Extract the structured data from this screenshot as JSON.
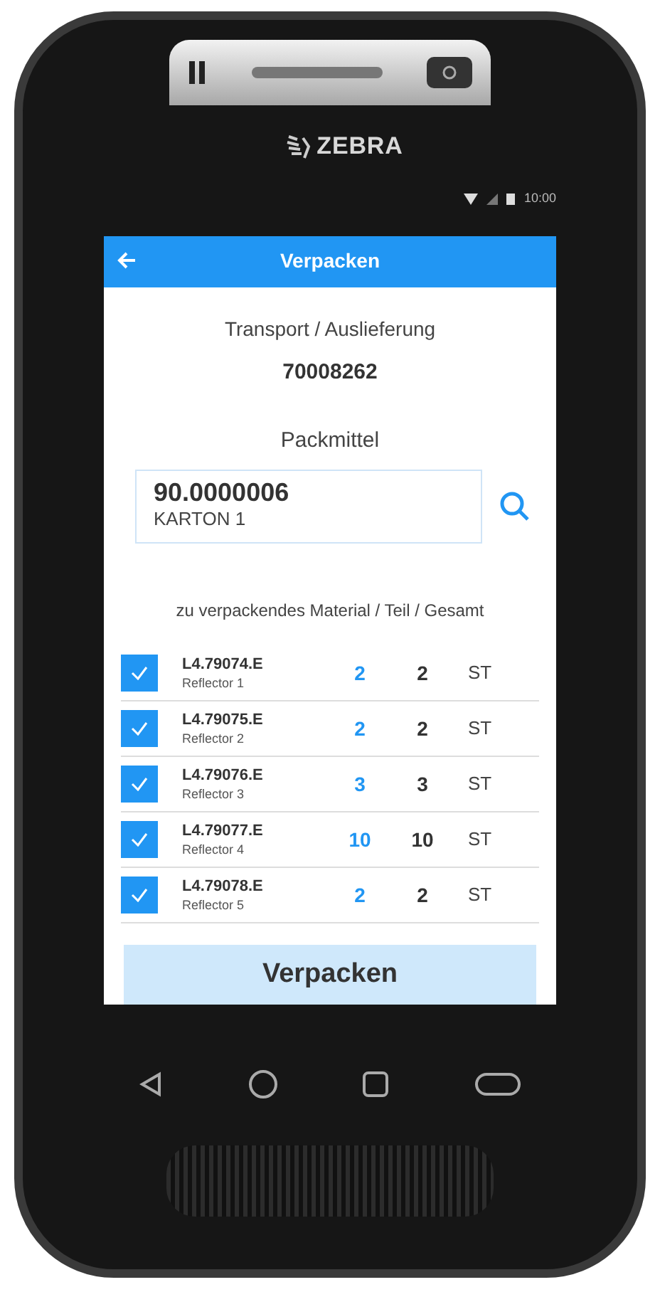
{
  "device": {
    "brand": "ZEBRA"
  },
  "status_bar": {
    "time": "10:00"
  },
  "app_bar": {
    "title": "Verpacken"
  },
  "delivery": {
    "label": "Transport / Auslieferung",
    "number": "70008262"
  },
  "packmittel": {
    "label": "Packmittel",
    "code": "90.0000006",
    "name": "KARTON 1"
  },
  "materials": {
    "heading": "zu verpackendes Material / Teil / Gesamt",
    "rows": [
      {
        "material": "L4.79074.E",
        "description": "Reflector 1",
        "part": "2",
        "total": "2",
        "unit": "ST",
        "checked": true
      },
      {
        "material": "L4.79075.E",
        "description": "Reflector 2",
        "part": "2",
        "total": "2",
        "unit": "ST",
        "checked": true
      },
      {
        "material": "L4.79076.E",
        "description": "Reflector 3",
        "part": "3",
        "total": "3",
        "unit": "ST",
        "checked": true
      },
      {
        "material": "L4.79077.E",
        "description": "Reflector 4",
        "part": "10",
        "total": "10",
        "unit": "ST",
        "checked": true
      },
      {
        "material": "L4.79078.E",
        "description": "Reflector 5",
        "part": "2",
        "total": "2",
        "unit": "ST",
        "checked": true
      }
    ]
  },
  "primary_button": {
    "label": "Verpacken"
  }
}
